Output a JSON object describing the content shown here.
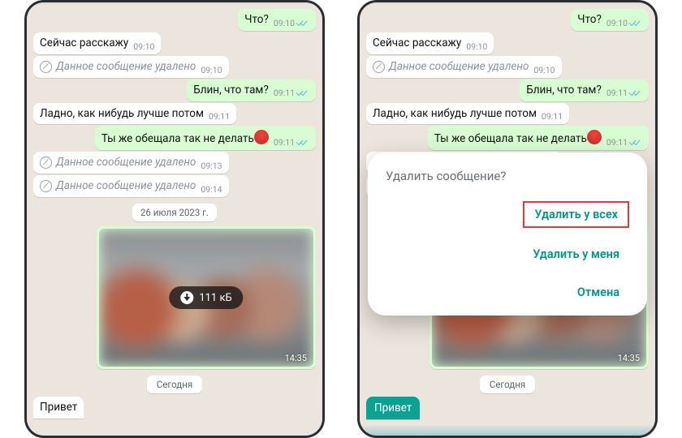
{
  "messages": {
    "m1": {
      "text": "Что?",
      "time": "09:10"
    },
    "m2": {
      "text": "Сейчас расскажу",
      "time": "09:10"
    },
    "m3": {
      "text": "Данное сообщение удалено",
      "time": "09:10"
    },
    "m4": {
      "text": "Блин, что там?",
      "time": "09:11"
    },
    "m5": {
      "text": "Ладно, как нибудь лучше потом",
      "time": "09:11"
    },
    "m6": {
      "text": "Ты же обещала так не делать",
      "time": "09:11"
    },
    "m7": {
      "text": "Данное сообщение удалено",
      "time": "09:13"
    },
    "m8": {
      "text": "Данное сообщение удалено",
      "time": "09:14"
    }
  },
  "date_chip": "26 июля 2023 г.",
  "image": {
    "size_label": "111 кБ",
    "time": "14:35"
  },
  "today_chip": "Сегодня",
  "bottom_msg": "Привет",
  "dialog": {
    "title": "Удалить сообщение?",
    "delete_all": "Удалить у всех",
    "delete_me": "Удалить у меня",
    "cancel": "Отмена"
  }
}
